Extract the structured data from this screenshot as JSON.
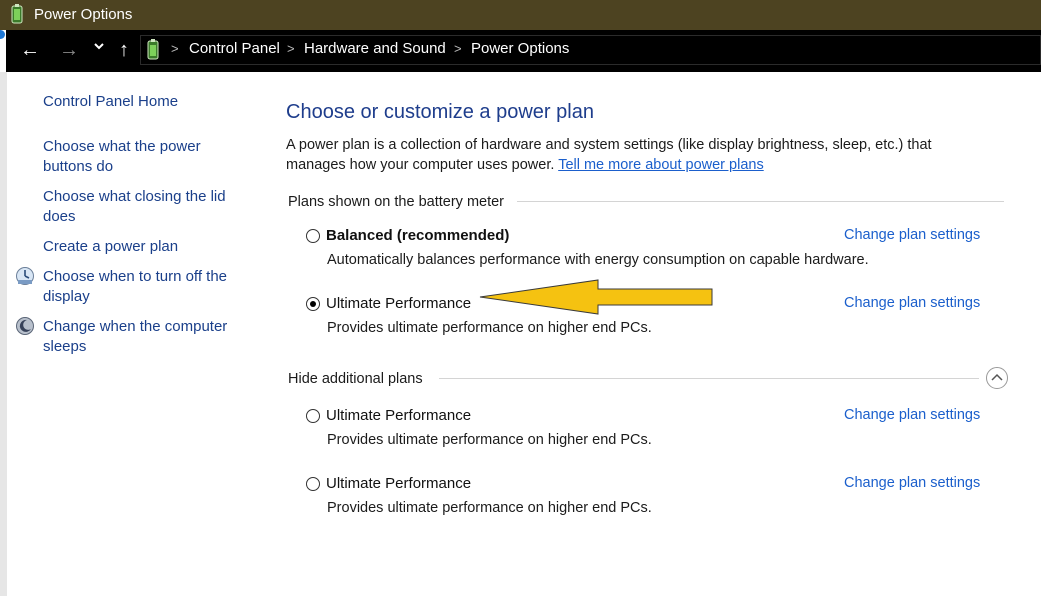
{
  "window": {
    "title": "Power Options"
  },
  "nav": {
    "back": "←",
    "forward": "→",
    "recent": "⌄",
    "up": "↑",
    "breadcrumbs": [
      "Control Panel",
      "Hardware and Sound",
      "Power Options"
    ],
    "separator": ">"
  },
  "sidebar": {
    "items": [
      {
        "label_line1": "Control Panel Home",
        "label_line2": ""
      },
      {
        "label_line1": "Choose what the power",
        "label_line2": "buttons do"
      },
      {
        "label_line1": "Choose what closing the lid",
        "label_line2": "does"
      },
      {
        "label_line1": "Create a power plan",
        "label_line2": ""
      },
      {
        "label_line1": "Choose when to turn off the",
        "label_line2": "display",
        "icon": "display-icon"
      },
      {
        "label_line1": "Change when the computer",
        "label_line2": "sleeps",
        "icon": "sleep-icon"
      }
    ]
  },
  "main": {
    "heading": "Choose or customize a power plan",
    "intro_line1": "A power plan is a collection of hardware and system settings (like display brightness, sleep, etc.) that",
    "intro_line2": "manages how your computer uses power.",
    "intro_link": "Tell me more about power plans",
    "group1_label": "Plans shown on the battery meter",
    "group2_label": "Hide additional plans",
    "plans": [
      {
        "name": "Balanced (recommended)",
        "desc": "Automatically balances performance with energy consumption on capable hardware.",
        "change": "Change plan settings",
        "selected": false
      },
      {
        "name": "Ultimate Performance",
        "desc": "Provides ultimate performance on higher end PCs.",
        "change": "Change plan settings",
        "selected": true
      },
      {
        "name": "Ultimate Performance",
        "desc": "Provides ultimate performance on higher end PCs.",
        "change": "Change plan settings",
        "selected": false
      },
      {
        "name": "Ultimate Performance",
        "desc": "Provides ultimate performance on higher end PCs.",
        "change": "Change plan settings",
        "selected": false
      }
    ]
  },
  "colors": {
    "titlebar": "#4d4321",
    "address_bar": "#000000",
    "link": "#1b5fcc",
    "heading": "#1e3d8c",
    "annotation_arrow": "#f5c211"
  }
}
